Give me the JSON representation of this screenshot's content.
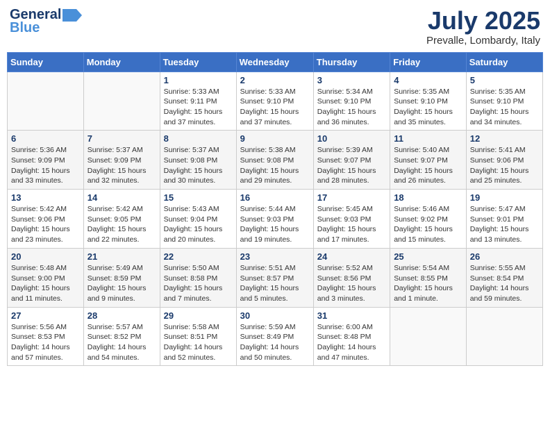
{
  "header": {
    "logo_line1": "General",
    "logo_line2": "Blue",
    "month": "July 2025",
    "location": "Prevalle, Lombardy, Italy"
  },
  "weekdays": [
    "Sunday",
    "Monday",
    "Tuesday",
    "Wednesday",
    "Thursday",
    "Friday",
    "Saturday"
  ],
  "weeks": [
    [
      {
        "day": "",
        "detail": ""
      },
      {
        "day": "",
        "detail": ""
      },
      {
        "day": "1",
        "detail": "Sunrise: 5:33 AM\nSunset: 9:11 PM\nDaylight: 15 hours\nand 37 minutes."
      },
      {
        "day": "2",
        "detail": "Sunrise: 5:33 AM\nSunset: 9:10 PM\nDaylight: 15 hours\nand 37 minutes."
      },
      {
        "day": "3",
        "detail": "Sunrise: 5:34 AM\nSunset: 9:10 PM\nDaylight: 15 hours\nand 36 minutes."
      },
      {
        "day": "4",
        "detail": "Sunrise: 5:35 AM\nSunset: 9:10 PM\nDaylight: 15 hours\nand 35 minutes."
      },
      {
        "day": "5",
        "detail": "Sunrise: 5:35 AM\nSunset: 9:10 PM\nDaylight: 15 hours\nand 34 minutes."
      }
    ],
    [
      {
        "day": "6",
        "detail": "Sunrise: 5:36 AM\nSunset: 9:09 PM\nDaylight: 15 hours\nand 33 minutes."
      },
      {
        "day": "7",
        "detail": "Sunrise: 5:37 AM\nSunset: 9:09 PM\nDaylight: 15 hours\nand 32 minutes."
      },
      {
        "day": "8",
        "detail": "Sunrise: 5:37 AM\nSunset: 9:08 PM\nDaylight: 15 hours\nand 30 minutes."
      },
      {
        "day": "9",
        "detail": "Sunrise: 5:38 AM\nSunset: 9:08 PM\nDaylight: 15 hours\nand 29 minutes."
      },
      {
        "day": "10",
        "detail": "Sunrise: 5:39 AM\nSunset: 9:07 PM\nDaylight: 15 hours\nand 28 minutes."
      },
      {
        "day": "11",
        "detail": "Sunrise: 5:40 AM\nSunset: 9:07 PM\nDaylight: 15 hours\nand 26 minutes."
      },
      {
        "day": "12",
        "detail": "Sunrise: 5:41 AM\nSunset: 9:06 PM\nDaylight: 15 hours\nand 25 minutes."
      }
    ],
    [
      {
        "day": "13",
        "detail": "Sunrise: 5:42 AM\nSunset: 9:06 PM\nDaylight: 15 hours\nand 23 minutes."
      },
      {
        "day": "14",
        "detail": "Sunrise: 5:42 AM\nSunset: 9:05 PM\nDaylight: 15 hours\nand 22 minutes."
      },
      {
        "day": "15",
        "detail": "Sunrise: 5:43 AM\nSunset: 9:04 PM\nDaylight: 15 hours\nand 20 minutes."
      },
      {
        "day": "16",
        "detail": "Sunrise: 5:44 AM\nSunset: 9:03 PM\nDaylight: 15 hours\nand 19 minutes."
      },
      {
        "day": "17",
        "detail": "Sunrise: 5:45 AM\nSunset: 9:03 PM\nDaylight: 15 hours\nand 17 minutes."
      },
      {
        "day": "18",
        "detail": "Sunrise: 5:46 AM\nSunset: 9:02 PM\nDaylight: 15 hours\nand 15 minutes."
      },
      {
        "day": "19",
        "detail": "Sunrise: 5:47 AM\nSunset: 9:01 PM\nDaylight: 15 hours\nand 13 minutes."
      }
    ],
    [
      {
        "day": "20",
        "detail": "Sunrise: 5:48 AM\nSunset: 9:00 PM\nDaylight: 15 hours\nand 11 minutes."
      },
      {
        "day": "21",
        "detail": "Sunrise: 5:49 AM\nSunset: 8:59 PM\nDaylight: 15 hours\nand 9 minutes."
      },
      {
        "day": "22",
        "detail": "Sunrise: 5:50 AM\nSunset: 8:58 PM\nDaylight: 15 hours\nand 7 minutes."
      },
      {
        "day": "23",
        "detail": "Sunrise: 5:51 AM\nSunset: 8:57 PM\nDaylight: 15 hours\nand 5 minutes."
      },
      {
        "day": "24",
        "detail": "Sunrise: 5:52 AM\nSunset: 8:56 PM\nDaylight: 15 hours\nand 3 minutes."
      },
      {
        "day": "25",
        "detail": "Sunrise: 5:54 AM\nSunset: 8:55 PM\nDaylight: 15 hours\nand 1 minute."
      },
      {
        "day": "26",
        "detail": "Sunrise: 5:55 AM\nSunset: 8:54 PM\nDaylight: 14 hours\nand 59 minutes."
      }
    ],
    [
      {
        "day": "27",
        "detail": "Sunrise: 5:56 AM\nSunset: 8:53 PM\nDaylight: 14 hours\nand 57 minutes."
      },
      {
        "day": "28",
        "detail": "Sunrise: 5:57 AM\nSunset: 8:52 PM\nDaylight: 14 hours\nand 54 minutes."
      },
      {
        "day": "29",
        "detail": "Sunrise: 5:58 AM\nSunset: 8:51 PM\nDaylight: 14 hours\nand 52 minutes."
      },
      {
        "day": "30",
        "detail": "Sunrise: 5:59 AM\nSunset: 8:49 PM\nDaylight: 14 hours\nand 50 minutes."
      },
      {
        "day": "31",
        "detail": "Sunrise: 6:00 AM\nSunset: 8:48 PM\nDaylight: 14 hours\nand 47 minutes."
      },
      {
        "day": "",
        "detail": ""
      },
      {
        "day": "",
        "detail": ""
      }
    ]
  ]
}
